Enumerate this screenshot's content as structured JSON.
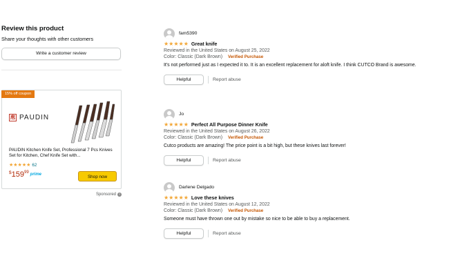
{
  "sidebar": {
    "title": "Review this product",
    "subtitle": "Share your thoughts with other customers",
    "write_review_label": "Write a customer review"
  },
  "ad": {
    "coupon": "15% off coupon",
    "brand": "PAUDIN",
    "brand_mark": "庖",
    "title": "PAUDIN Kitchen Knife Set, Professional 7 Pcs Knives Set for Kitchen, Chef Knife Set with...",
    "stars": "★★★★★",
    "rating_count": "62",
    "price_dollar": "$",
    "price_whole": "159",
    "price_fraction": "99",
    "prime": "prime",
    "shop_now_label": "Shop now",
    "sponsored": "Sponsored",
    "info_icon": "i"
  },
  "reviews": [
    {
      "author": "fam5390",
      "stars": "★★★★★",
      "title": "Great knife",
      "meta": "Reviewed in the United States on August 25, 2022",
      "color": "Color: Classic (Dark Brown)",
      "verified": "Verified Purchase",
      "body": "It's not performed just as I expected it to. It is an excellent replacement for aloft knife. I think CUTCO Brand is awesome.",
      "helpful": "Helpful",
      "report": "Report abuse"
    },
    {
      "author": "Jo",
      "stars": "★★★★★",
      "title": "Perfect All Purpose Dinner Knife",
      "meta": "Reviewed in the United States on August 26, 2022",
      "color": "Color: Classic (Dark Brown)",
      "verified": "Verified Purchase",
      "body": "Cutco products are amazing! The price point is a bit high, but these knives last forever!",
      "helpful": "Helpful",
      "report": "Report abuse"
    },
    {
      "author": "Darlene Delgado",
      "stars": "★★★★★",
      "title": "Love these knives",
      "meta": "Reviewed in the United States on August 12, 2022",
      "color": "Color: Classic (Dark Brown)",
      "verified": "Verified Purchase",
      "body": "Someone must have thrown one out by mistake so nice to be able to buy a replacement.",
      "helpful": "Helpful",
      "report": "Report abuse"
    }
  ],
  "colors": {
    "star": "#f2a533",
    "verified": "#c45500",
    "price": "#b12704",
    "button": "#f7ca00",
    "coupon": "#e47911"
  }
}
